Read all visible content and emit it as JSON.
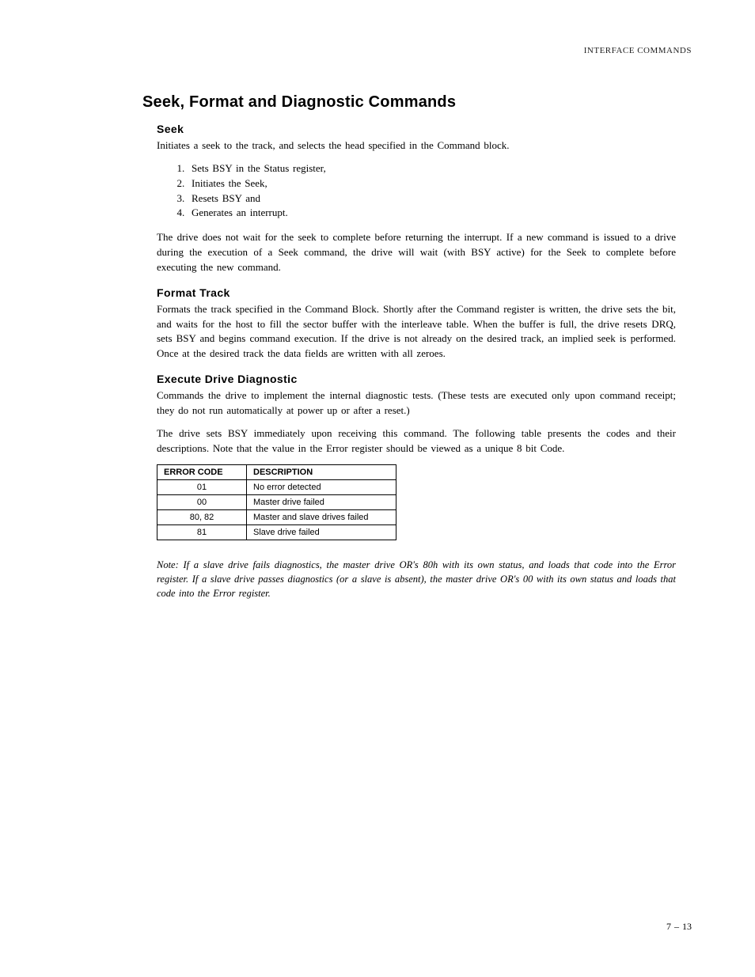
{
  "header": {
    "right": "INTERFACE COMMANDS"
  },
  "section": {
    "title": "Seek, Format and Diagnostic Commands",
    "seek": {
      "heading": "Seek",
      "intro": "Initiates a seek to the track, and selects the head specified in the Command block.",
      "list": [
        "Sets BSY in the Status register,",
        "Initiates the Seek,",
        "Resets BSY and",
        "Generates an interrupt."
      ],
      "para2": "The drive does not wait for the seek to complete before returning the interrupt. If a new command is issued to a drive during the execution of a Seek command, the drive will wait (with BSY active) for the Seek to complete before executing the new command."
    },
    "format": {
      "heading": "Format Track",
      "para": "Formats the track specified in the Command Block. Shortly after the Command register is written, the drive sets the  bit, and waits for the host to fill the sector buffer with the interleave table. When the buffer is full, the drive resets DRQ, sets BSY and begins command execution. If the drive is not already on the desired track, an implied seek is performed. Once at the desired track the data fields are written with all zeroes."
    },
    "diag": {
      "heading": "Execute Drive Diagnostic",
      "para1": "Commands the drive to implement the internal diagnostic tests. (These tests are executed only upon command receipt; they do not run automatically at power up or after a reset.)",
      "para2": "The drive sets BSY immediately upon receiving this command. The following table presents the codes and their descriptions. Note that the value in the Error register should be viewed as a unique 8 bit Code.",
      "table": {
        "headers": {
          "code": "ERROR CODE",
          "desc": "DESCRIPTION"
        },
        "rows": [
          {
            "code": "01",
            "desc": "No error detected"
          },
          {
            "code": "00",
            "desc": "Master drive failed"
          },
          {
            "code": "80, 82",
            "desc": "Master and slave drives failed"
          },
          {
            "code": "81",
            "desc": "Slave drive failed"
          }
        ]
      },
      "note": "Note: If a slave drive fails diagnostics, the master drive OR's 80h with its own status, and loads that code into the Error register. If a slave drive passes diagnostics (or a slave is absent), the master drive OR's 00 with its own status and loads that code into the Error register."
    }
  },
  "footer": {
    "pagenum": "7 – 13"
  }
}
